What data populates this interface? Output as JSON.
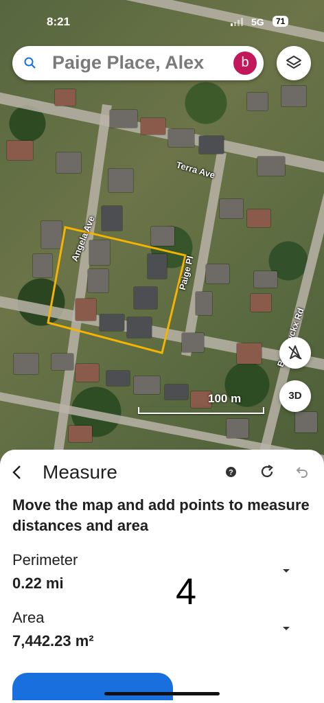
{
  "status_bar": {
    "time": "8:21",
    "network": "5G",
    "battery": "71"
  },
  "search": {
    "text": "Paige Place, Alex",
    "avatar_letter": "b"
  },
  "map": {
    "streets": [
      "Terra Ave",
      "Angela Ave",
      "Paige Pl",
      "Brunswckx Rd"
    ],
    "scale_label": "100 m",
    "button_3d": "3D",
    "measure_color": "#f4b400"
  },
  "sheet": {
    "title": "Measure",
    "instruction": "Move the map and add points to measure distances and area",
    "perimeter_label": "Perimeter",
    "perimeter_value": "0.22 mi",
    "area_label": "Area",
    "area_value": "7,442.23 m²",
    "points_count": "4"
  },
  "colors": {
    "accent": "#1a6fde",
    "avatar": "#c2185b"
  }
}
